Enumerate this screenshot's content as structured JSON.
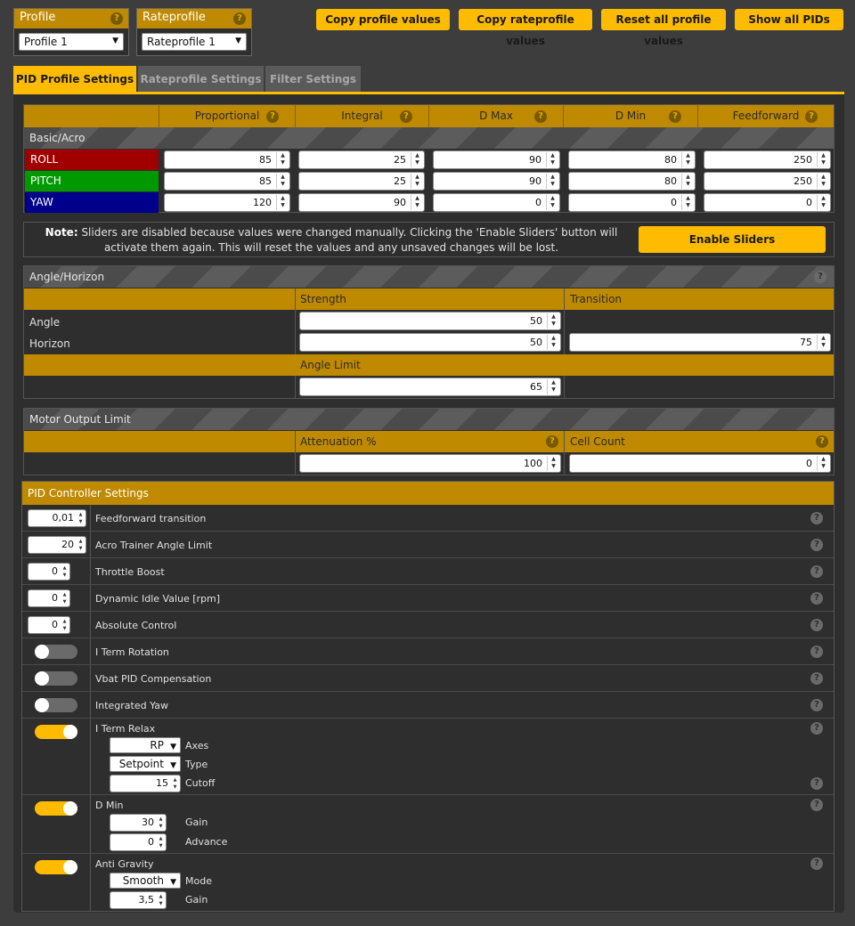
{
  "header": {
    "profile": {
      "label": "Profile",
      "value": "Profile 1"
    },
    "rateprofile": {
      "label": "Rateprofile",
      "value": "Rateprofile 1"
    },
    "buttons": {
      "copy_profile": "Copy profile values",
      "copy_rateprofile": "Copy rateprofile values",
      "reset_all": "Reset all profile values",
      "show_all": "Show all PIDs"
    }
  },
  "tabs": {
    "pid": "PID Profile Settings",
    "rate": "Rateprofile Settings",
    "filter": "Filter Settings"
  },
  "pid_table": {
    "columns": {
      "p": "Proportional",
      "i": "Integral",
      "dmax": "D Max",
      "dmin": "D Min",
      "ff": "Feedforward"
    },
    "section": "Basic/Acro",
    "rows": [
      {
        "axis": "ROLL",
        "color": "#a00000",
        "p": "85",
        "i": "25",
        "dmax": "90",
        "dmin": "80",
        "ff": "250"
      },
      {
        "axis": "PITCH",
        "color": "#009a00",
        "p": "85",
        "i": "25",
        "dmax": "90",
        "dmin": "80",
        "ff": "250"
      },
      {
        "axis": "YAW",
        "color": "#00008c",
        "p": "120",
        "i": "90",
        "dmax": "0",
        "dmin": "0",
        "ff": "0"
      }
    ]
  },
  "note": {
    "bold": "Note:",
    "text": " Sliders are disabled because values were changed manually. Clicking the 'Enable Sliders' button will activate them again. This will reset the values and any unsaved changes will be lost.",
    "button": "Enable Sliders"
  },
  "angle_horizon": {
    "title": "Angle/Horizon",
    "strength_label": "Strength",
    "transition_label": "Transition",
    "angle_label": "Angle",
    "horizon_label": "Horizon",
    "angle_strength": "50",
    "horizon_strength": "50",
    "horizon_transition": "75",
    "angle_limit_label": "Angle Limit",
    "angle_limit": "65"
  },
  "motor_output": {
    "title": "Motor Output Limit",
    "attenuation_label": "Attenuation %",
    "cell_count_label": "Cell Count",
    "attenuation": "100",
    "cell_count": "0"
  },
  "controller": {
    "title": "PID Controller Settings",
    "ff_transition": {
      "label": "Feedforward transition",
      "value": "0,01"
    },
    "acro_trainer": {
      "label": "Acro Trainer Angle Limit",
      "value": "20"
    },
    "throttle_boost": {
      "label": "Throttle Boost",
      "value": "0"
    },
    "dynamic_idle": {
      "label": "Dynamic Idle Value [rpm]",
      "value": "0"
    },
    "absolute_control": {
      "label": "Absolute Control",
      "value": "0"
    },
    "iterm_rotation": {
      "label": "I Term Rotation"
    },
    "vbat_comp": {
      "label": "Vbat PID Compensation"
    },
    "integrated_yaw": {
      "label": "Integrated Yaw"
    },
    "iterm_relax": {
      "label": "I Term Relax",
      "axes_label": "Axes",
      "axes_value": "RP",
      "type_label": "Type",
      "type_value": "Setpoint",
      "cutoff_label": "Cutoff",
      "cutoff_value": "15"
    },
    "d_min": {
      "label": "D Min",
      "gain_label": "Gain",
      "gain_value": "30",
      "advance_label": "Advance",
      "advance_value": "0"
    },
    "anti_gravity": {
      "label": "Anti Gravity",
      "mode_label": "Mode",
      "mode_value": "Smooth",
      "gain_label": "Gain",
      "gain_value": "3,5"
    }
  },
  "icons": {
    "help": "help-icon",
    "dropdown": "chevron-down-icon",
    "spinner": "spinner-arrows-icon"
  },
  "colors": {
    "accent": "#ffbb00",
    "header_gold": "#c08a00"
  }
}
